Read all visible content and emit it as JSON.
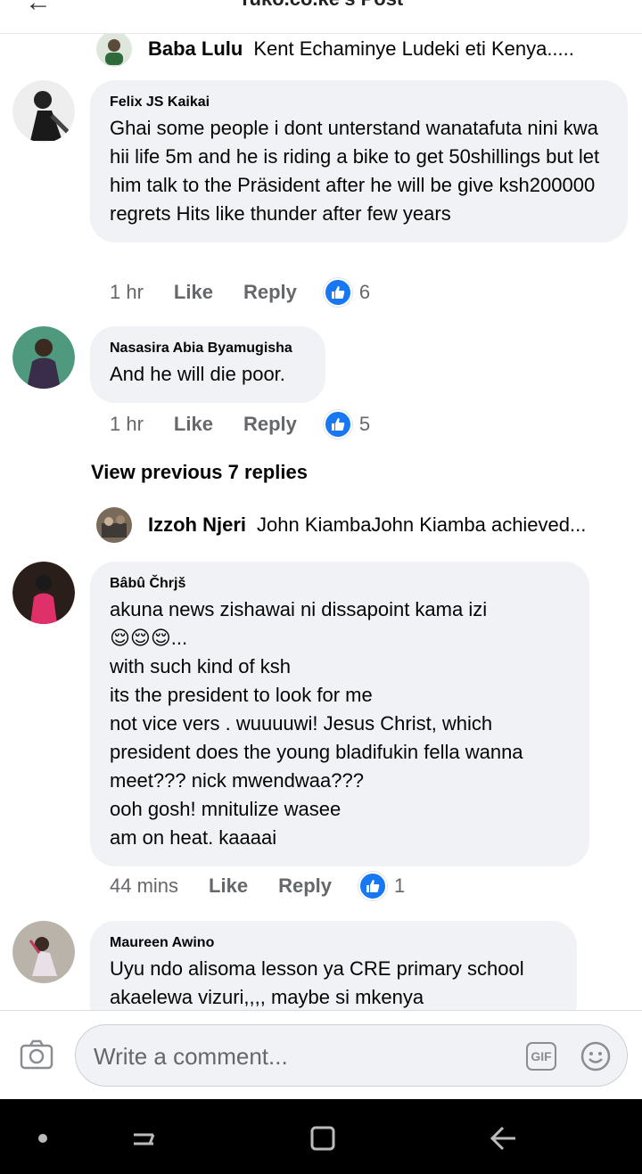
{
  "header": {
    "title": "Tuko.co.ke's Post",
    "back_icon": "back-arrow-icon"
  },
  "comments": [
    {
      "type": "collapsed",
      "name": "Baba Lulu",
      "preview": "Kent Echaminye Ludeki eti Kenya....."
    },
    {
      "type": "full",
      "author": "Felix JS Kaikai",
      "text": "Ghai some people i dont unterstand wanatafuta nini kwa hii life 5m and he is riding a bike to get 50shillings  but let him talk to the Präsident after he will be give ksh200000 regrets Hits like thunder after few years",
      "time": "1 hr",
      "like_label": "Like",
      "reply_label": "Reply",
      "reactions": "6"
    },
    {
      "type": "full",
      "author": "Nasasira Abia Byamugisha",
      "text": "And he will die poor.",
      "time": "1 hr",
      "like_label": "Like",
      "reply_label": "Reply",
      "reactions": "5"
    },
    {
      "type": "view_previous",
      "label": "View previous 7 replies"
    },
    {
      "type": "collapsed",
      "name": "Izzoh Njeri",
      "preview": "John KiambaJohn Kiamba achieved..."
    },
    {
      "type": "full",
      "author": "Bâbû Čhrjš",
      "text": "akuna news  zishawai ni dissapoint kama izi\n😌😌😌...\nwith  such kind of ksh\nits the  president to look for me\nnot  vice vers . wuuuuwi!  Jesus  Christ,  which president  does the young bladifukin fella wanna meet???  nick mwendwaa???\nooh gosh!   mnitulize wasee\nam on heat. kaaaai",
      "time": "44 mins",
      "like_label": "Like",
      "reply_label": "Reply",
      "reactions": "1"
    },
    {
      "type": "full",
      "author": "Maureen Awino",
      "text": "Uyu ndo alisoma lesson ya CRE primary school akaelewa vizuri,,,, maybe si mkenya"
    }
  ],
  "composer": {
    "placeholder": "Write a comment...",
    "gif_label": "GIF"
  },
  "colors": {
    "accent": "#1877f2",
    "bubble": "#f0f2f5",
    "meta": "#65676b"
  }
}
